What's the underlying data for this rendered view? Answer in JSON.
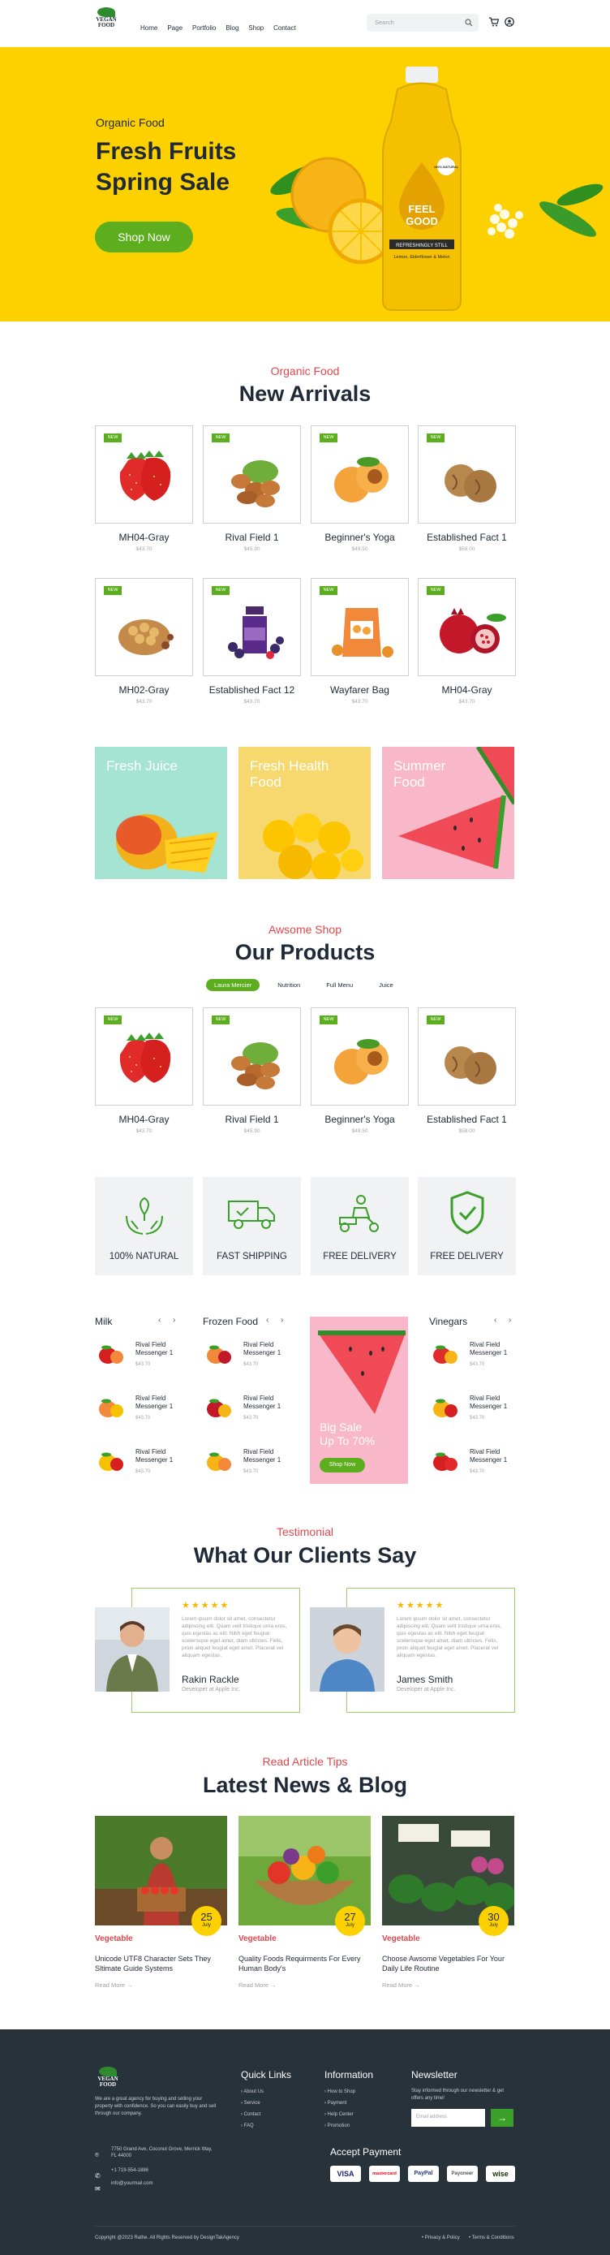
{
  "header": {
    "logo": {
      "line1": "VEGAN",
      "line2": "FOOD"
    },
    "nav": [
      "Home",
      "Page",
      "Portfolio",
      "Blog",
      "Shop",
      "Contact"
    ],
    "search_placeholder": "Search"
  },
  "hero": {
    "subtitle": "Organic Food",
    "title_line1": "Fresh Fruits",
    "title_line2": "Spring Sale",
    "button": "Shop Now",
    "bottle_label1": "FEEL",
    "bottle_label2": "GOOD",
    "bottle_label3": "REFRESHINGLY STILL",
    "bottle_label4": "Lemon, Elderflower & Melon",
    "bottle_badge": "100% NATURAL"
  },
  "new_arrivals": {
    "tag": "Organic Food",
    "title": "New Arrivals",
    "badge": "NEW",
    "products": [
      {
        "name": "MH04-Gray",
        "price": "$43.70",
        "icon": "strawberry-icon"
      },
      {
        "name": "Rival Field  1",
        "price": "$45.90",
        "icon": "almond-icon"
      },
      {
        "name": "Beginner's Yoga",
        "price": "$49.50",
        "icon": "apricot-icon"
      },
      {
        "name": "Established Fact 1",
        "price": "$58.00",
        "icon": "walnut-icon"
      },
      {
        "name": "MH02-Gray",
        "price": "$43.70",
        "icon": "nut-bowl-icon"
      },
      {
        "name": "Established Fact 12",
        "price": "$43.70",
        "icon": "berry-bottle-icon"
      },
      {
        "name": "Wayfarer Bag",
        "price": "$43.70",
        "icon": "dried-apricot-bag-icon"
      },
      {
        "name": "MH04-Gray",
        "price": "$43.70",
        "icon": "pomegranate-icon"
      }
    ]
  },
  "banners": [
    {
      "line1": "Fresh Juice",
      "line2": "",
      "color": "#a5e3d2"
    },
    {
      "line1": "Fresh Health",
      "line2": "Food",
      "color": "#f6d86e"
    },
    {
      "line1": "Summer",
      "line2": "Food",
      "color": "#f8b8c9"
    }
  ],
  "our_products": {
    "tag": "Awsome Shop",
    "title": "Our Products",
    "tabs": [
      "Laura Mercier",
      "Nutrition",
      "Full Menu",
      "Juice"
    ],
    "products": [
      {
        "name": "MH04-Gray",
        "price": "$43.70"
      },
      {
        "name": "Rival Field  1",
        "price": "$45.90"
      },
      {
        "name": "Beginner's Yoga",
        "price": "$49.50"
      },
      {
        "name": "Established Fact 1",
        "price": "$58.00"
      }
    ]
  },
  "features": [
    "100% NATURAL",
    "FAST SHIPPING",
    "FREE DELIVERY",
    "FREE DELIVERY"
  ],
  "mini_lists": [
    {
      "heading": "Milk",
      "items": [
        {
          "name": "Rival Field Messenger 1",
          "price": "$43.70"
        },
        {
          "name": "Rival Field Messenger 1",
          "price": "$43.70"
        },
        {
          "name": "Rival Field Messenger 1",
          "price": "$43.70"
        }
      ]
    },
    {
      "heading": "Frozen Food",
      "items": [
        {
          "name": "Rival Field Messenger 1",
          "price": "$43.70"
        },
        {
          "name": "Rival Field Messenger 1",
          "price": "$43.70"
        },
        {
          "name": "Rival Field Messenger 1",
          "price": "$43.70"
        }
      ]
    },
    {
      "heading": "Vinegars",
      "items": [
        {
          "name": "Rival Field Messenger 1",
          "price": "$43.70"
        },
        {
          "name": "Rival Field Messenger 1",
          "price": "$43.70"
        },
        {
          "name": "Rival Field Messenger 1",
          "price": "$43.70"
        }
      ]
    }
  ],
  "big_sale": {
    "line1": "Big Sale",
    "line2": "Up To 70%",
    "button": "Shop Now"
  },
  "testimonial": {
    "tag": "Testimonial",
    "title": "What Our  Clients Say",
    "items": [
      {
        "text": "Lorem ipsum dolor sit amet, consectetur adipiscing elit. Quam velit tristique urna eros, quis egestas ac elit. Nibh eget feugiat scelerisque eget amet, diam ultricies. Felis, proin aliquet feugiat eget amet. Placerat vel aliquam egestas.",
        "name": "Rakin Rackle",
        "role": "Developer at Apple Inc."
      },
      {
        "text": "Lorem ipsum dolor sit amet, consectetur adipiscing elit. Quam velit tristique urna eros, quis egestas ac elit. Nibh eget feugiat scelerisque eget amet, diam ultricies. Felis, proin aliquet feugiat eget amet. Placerat vel aliquam egestas.",
        "name": "James Smith",
        "role": "Developer at Apple Inc."
      }
    ]
  },
  "blog": {
    "tag": "Read Article Tips",
    "title": "Latest News & Blog",
    "posts": [
      {
        "day": "25",
        "month": "July",
        "category": "Vegetable",
        "title": "Unicode UTF8 Character Sets They Sltimate Guide Systems",
        "more": "Read More"
      },
      {
        "day": "27",
        "month": "July",
        "category": "Vegetable",
        "title": "Quality Foods Requirments For Every Human Body's",
        "more": "Read More"
      },
      {
        "day": "30",
        "month": "July",
        "category": "Vegetable",
        "title": "Choose Awsome Vegetables For Your Daily Life Routine",
        "more": "Read More"
      }
    ]
  },
  "footer": {
    "about": "We are a great agency for buying and selling your property with confidence. So you can easily buy and sell through our company.",
    "address": "7750 Grand Ave, Coconut Grove, Merrick Way, FL 44000",
    "phone": "+1 719-554-1886",
    "email": "info@yourmail.com",
    "quick_links": {
      "title": "Quick Links",
      "items": [
        "About Us",
        "Service",
        "Contact",
        "FAQ"
      ]
    },
    "information": {
      "title": "Information",
      "items": [
        "How to Shop",
        "Payment",
        "Help Center",
        "Promotion"
      ]
    },
    "newsletter": {
      "title": "Newsletter",
      "text": "Stay informed through our newsletter & get offers any time!",
      "placeholder": "Email address"
    },
    "payment_title": "Accept Payment",
    "payments": [
      "VISA",
      "mastercard",
      "PayPal",
      "Payoneer",
      "wise"
    ],
    "copyright": "Copyright @2023 Rathe. All Rights Reserved by DesignTakAgency",
    "legal": [
      "Privacy & Policy",
      "Terms & Conditions"
    ]
  },
  "colors": {
    "accent": "#5cae1e",
    "red": "#e0474c",
    "hero_bg": "#fdd100",
    "footer_bg": "#28323b"
  }
}
